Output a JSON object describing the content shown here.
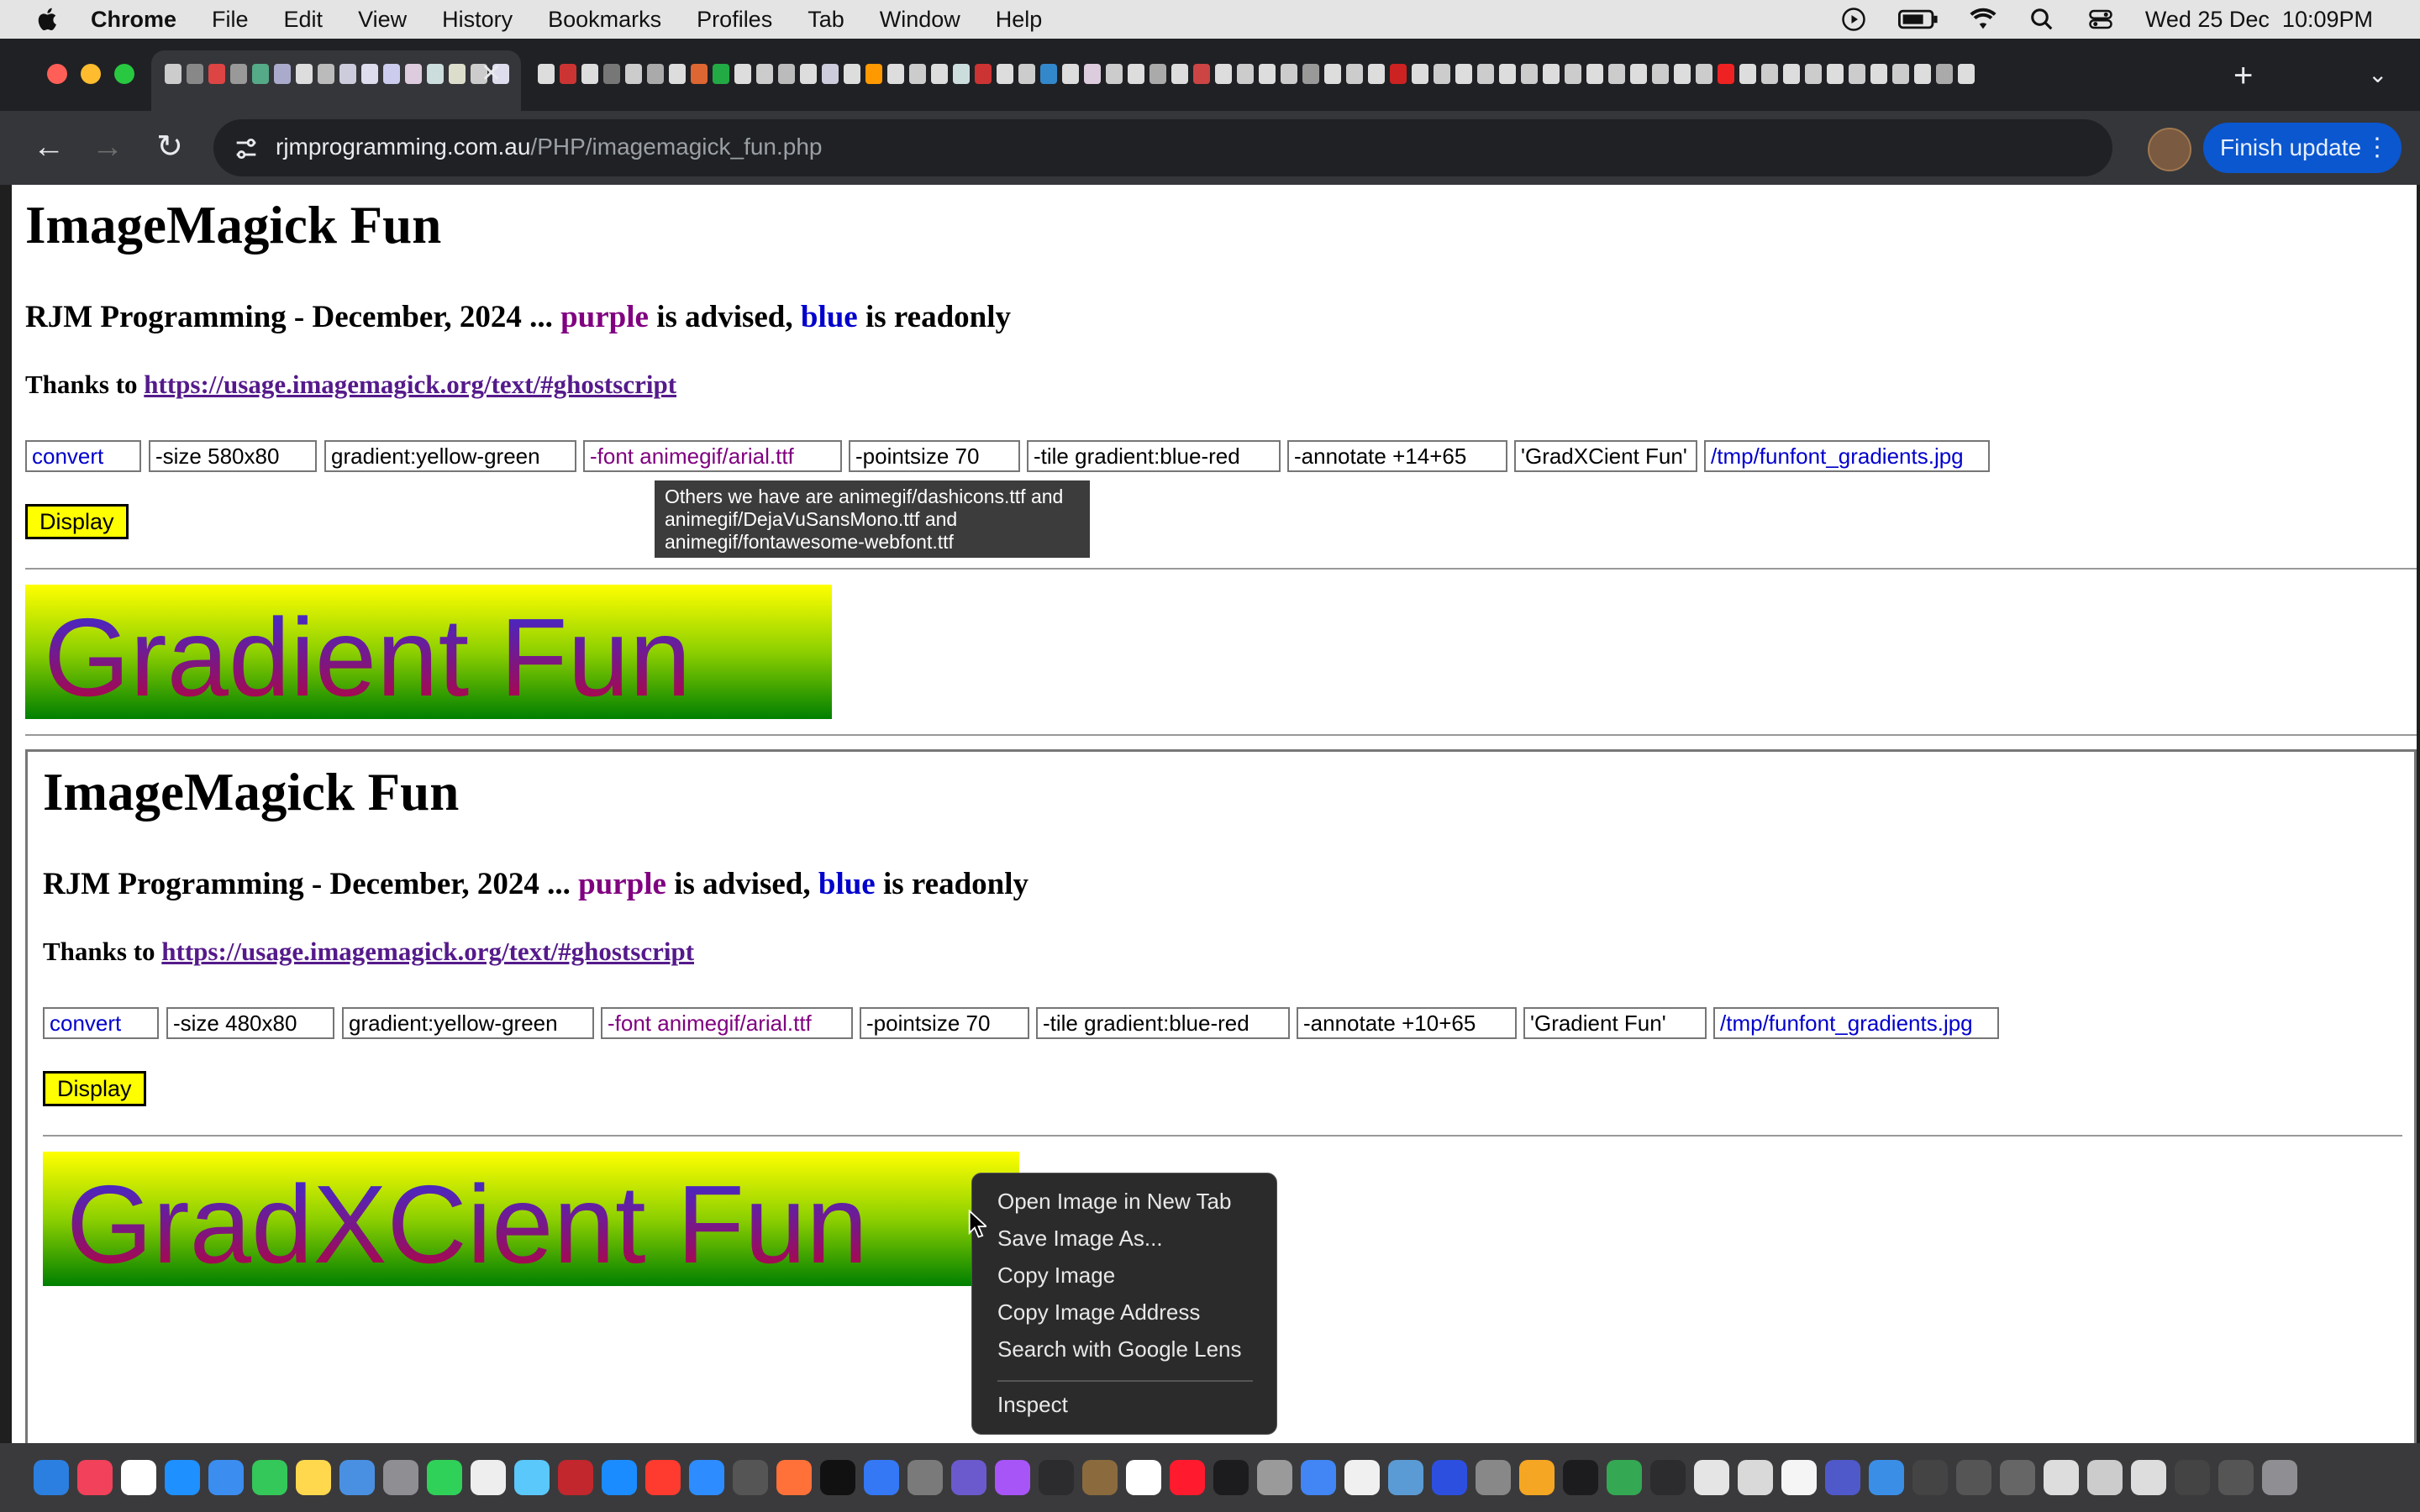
{
  "menubar": {
    "app_name": "Chrome",
    "items": [
      "File",
      "Edit",
      "View",
      "History",
      "Bookmarks",
      "Profiles",
      "Tab",
      "Window",
      "Help"
    ],
    "clock": "Wed 25 Dec  10:09PM"
  },
  "toolbar": {
    "url_host": "rjmprogramming.com.au",
    "url_path": "/PHP/imagemagick_fun.php",
    "finish_update_label": "Finish update"
  },
  "page": {
    "title": "ImageMagick Fun",
    "byline_prefix": "RJM Programming - December, 2024 ... ",
    "purple_word": "purple",
    "advised_text": " is advised, ",
    "blue_word": "blue",
    "readonly_text": " is readonly",
    "thanks_prefix": "Thanks to ",
    "thanks_link": "https://usage.imagemagick.org/text/#ghostscript",
    "fields": [
      "convert",
      "-size 580x80",
      "gradient:yellow-green",
      "-font animegif/arial.ttf",
      "-pointsize 70",
      "-tile gradient:blue-red",
      "-annotate +14+65",
      "'GradXCient Fun'",
      "/tmp/funfont_gradients.jpg"
    ],
    "display_label": "Display",
    "tooltip": "Others we have are animegif/dashicons.ttf and animegif/DejaVuSansMono.ttf and animegif/fontawesome-webfont.ttf",
    "image_text": "Gradient Fun"
  },
  "iframe": {
    "title": "ImageMagick Fun",
    "byline_prefix": "RJM Programming - December, 2024 ... ",
    "purple_word": "purple",
    "advised_text": " is advised, ",
    "blue_word": "blue",
    "readonly_text": " is readonly",
    "thanks_prefix": "Thanks to ",
    "thanks_link": "https://usage.imagemagick.org/text/#ghostscript",
    "fields": [
      "convert",
      "-size 480x80",
      "gradient:yellow-green",
      "-font animegif/arial.ttf",
      "-pointsize 70",
      "-tile gradient:blue-red",
      "-annotate +10+65",
      "'Gradient Fun'",
      "/tmp/funfont_gradients.jpg"
    ],
    "display_label": "Display",
    "image_text": "GradXCient Fun"
  },
  "context_menu": {
    "items": [
      "Open Image in New Tab",
      "Save Image As...",
      "Copy Image",
      "Copy Image Address",
      "Search with Google Lens"
    ],
    "inspect": "Inspect"
  },
  "colors": {
    "purple_advised": "#800080",
    "blue_readonly": "#0000cc",
    "display_button": "#ffff00"
  }
}
